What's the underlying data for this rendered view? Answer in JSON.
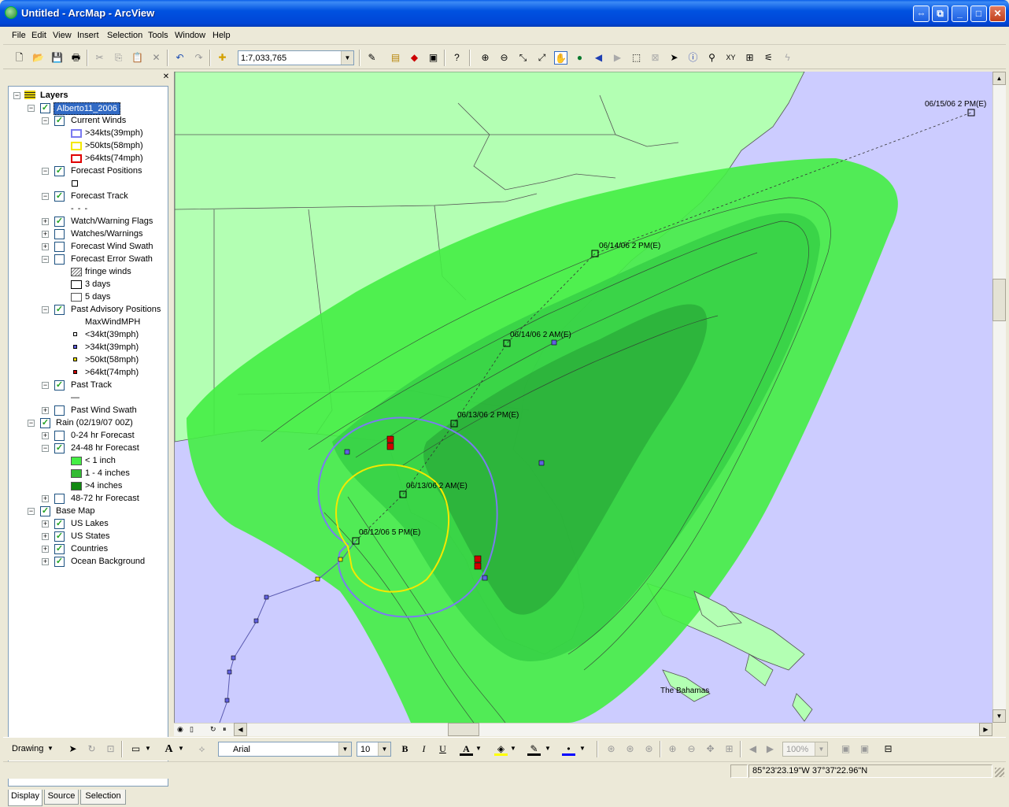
{
  "window": {
    "title": "Untitled - ArcMap - ArcView"
  },
  "menu": [
    "File",
    "Edit",
    "View",
    "Insert",
    "Selection",
    "Tools",
    "Window",
    "Help"
  ],
  "toolbar": {
    "map_scale": "1:7,033,765"
  },
  "toc": {
    "root": "Layers",
    "group_alberto": "Alberto11_2006",
    "current_winds": "Current Winds",
    "cw_34": ">34kts(39mph)",
    "cw_50": ">50kts(58mph)",
    "cw_64": ">64kts(74mph)",
    "forecast_positions": "Forecast Positions",
    "forecast_track": "Forecast Track",
    "forecast_track_sym": "- - -",
    "watch_flags": "Watch/Warning Flags",
    "watches": "Watches/Warnings",
    "wind_swath": "Forecast Wind Swath",
    "error_swath": "Forecast Error Swath",
    "fringe": "fringe winds",
    "days3": "3 days",
    "days5": "5 days",
    "past_positions": "Past Advisory Positions",
    "max_wind": "MaxWindMPH",
    "pp_lt34": "<34kt(39mph)",
    "pp_34": ">34kt(39mph)",
    "pp_50": ">50kt(58mph)",
    "pp_64": ">64kt(74mph)",
    "past_track": "Past Track",
    "past_track_sym": "—",
    "past_swath": "Past Wind Swath",
    "rain_group": "Rain (02/19/07 00Z)",
    "rain_0_24": "0-24 hr Forecast",
    "rain_24_48": "24-48 hr Forecast",
    "rain_lt1": "< 1 inch",
    "rain_1_4": "1 - 4 inches",
    "rain_gt4": ">4 inches",
    "rain_48_72": "48-72 hr Forecast",
    "base_map": "Base Map",
    "us_lakes": "US Lakes",
    "us_states": "US States",
    "countries": "Countries",
    "ocean": "Ocean Background",
    "tabs": [
      "Display",
      "Source",
      "Selection"
    ]
  },
  "colors": {
    "cw_34": "#7b7bf0",
    "cw_50": "#f4e800",
    "cw_64": "#e00000",
    "rain_lt1": "#44ee44",
    "rain_1_4": "#33bb33",
    "rain_gt4": "#118811",
    "ocean": "#ccccff",
    "land": "#b3ffb3"
  },
  "map": {
    "labels": {
      "f1": "06/15/06 2 PM(E)",
      "f2": "06/14/06 2 PM(E)",
      "f3": "06/14/06 2 AM(E)",
      "f4": "06/13/06 2 PM(E)",
      "f5": "06/13/06 2 AM(E)",
      "f6": "06/12/06 5 PM(E)",
      "bahamas": "The Bahamas"
    }
  },
  "drawing": {
    "label": "Drawing",
    "font": "Arial",
    "size": "10",
    "zoom": "100%"
  },
  "status": {
    "coordinates": "85°23'23.19\"W  37°37'22.96\"N"
  }
}
